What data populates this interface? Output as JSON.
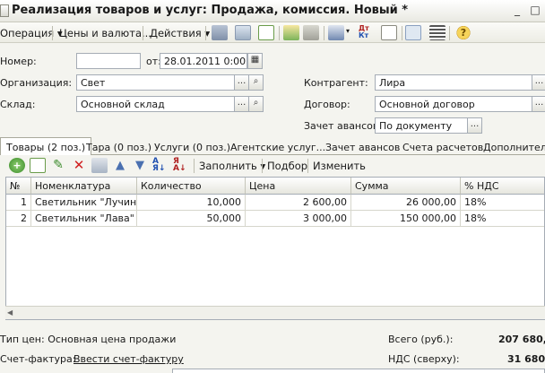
{
  "window": {
    "title": "Реализация товаров и услуг: Продажа, комиссия. Новый *"
  },
  "menubar": {
    "operation": "Операция",
    "prices": "Цены и валюта...",
    "actions": "Действия"
  },
  "header": {
    "number_label": "Номер:",
    "number_value": "",
    "date_label": "от:",
    "date_value": "28.01.2011  0:00:00",
    "org_label": "Организация:",
    "org_value": "Свет",
    "warehouse_label": "Склад:",
    "warehouse_value": "Основной склад",
    "counterparty_label": "Контрагент:",
    "counterparty_value": "Лира",
    "contract_label": "Договор:",
    "contract_value": "Основной договор",
    "advance_label": "Зачет авансов:",
    "advance_value": "По документу"
  },
  "tabs": [
    "Товары (2 поз.)",
    "Тара (0 поз.)",
    "Услуги (0 поз.)",
    "Агентские услуг...",
    "Зачет авансов",
    "Счета расчетов",
    "Дополнительно"
  ],
  "grid_toolbar": {
    "fill": "Заполнить",
    "select": "Подбор",
    "change": "Изменить"
  },
  "table": {
    "headers": [
      "№",
      "Номенклатура",
      "Количество",
      "Цена",
      "Сумма",
      "% НДС"
    ],
    "rows": [
      [
        "1",
        "Светильник \"Лучина\"",
        "10,000",
        "2 600,00",
        "26 000,00",
        "18%"
      ],
      [
        "2",
        "Светильник \"Лава\"",
        "50,000",
        "3 000,00",
        "150 000,00",
        "18%"
      ]
    ]
  },
  "footer": {
    "price_type": "Тип цен: Основная цена продажи",
    "total_label": "Всего (руб.):",
    "total_value": "207 680,",
    "invoice_label": "Счет-фактура:",
    "invoice_link": "Ввести счет-фактуру",
    "vat_label": "НДС (сверху):",
    "vat_value": "31 680,"
  }
}
